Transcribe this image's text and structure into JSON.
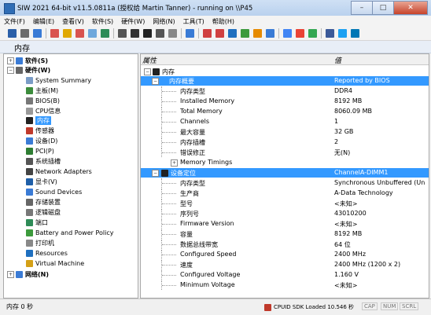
{
  "window": {
    "title": "SIW 2021 64-bit v11.5.0811a (授权给 Martin Tanner) - running on \\\\P45",
    "min": "–",
    "max": "□",
    "close": "✕"
  },
  "menu": [
    "文件(F)",
    "编辑(E)",
    "查看(V)",
    "软件(S)",
    "硬件(W)",
    "网络(N)",
    "工具(T)",
    "帮助(H)"
  ],
  "header": {
    "title": "内存"
  },
  "tree": {
    "software": "软件(S)",
    "hardware": "硬件(W)",
    "items": [
      "System Summary",
      "主板(M)",
      "BIOS(B)",
      "CPU信息",
      "内存",
      "传感器",
      "设备(D)",
      "PCI(P)",
      "系统插槽",
      "Network Adapters",
      "显卡(V)",
      "Sound Devices",
      "存储装置",
      "逻辑磁盘",
      "端口",
      "Battery and Power Policy",
      "打印机",
      "Resources",
      "Virtual Machine"
    ],
    "network": "网络(N)"
  },
  "columns": {
    "property": "属性",
    "value": "值"
  },
  "root": "内存",
  "sections": [
    {
      "title": "内存概要",
      "value": "Reported by BIOS",
      "rows": [
        {
          "p": "内存类型",
          "v": "DDR4"
        },
        {
          "p": "Installed Memory",
          "v": "8192 MB"
        },
        {
          "p": "Total Memory",
          "v": "8060.09 MB"
        },
        {
          "p": "Channels",
          "v": "1"
        },
        {
          "p": "最大容量",
          "v": "32 GB"
        },
        {
          "p": "内存插槽",
          "v": "2"
        },
        {
          "p": "错误修正",
          "v": "无(N)"
        },
        {
          "p": "Memory Timings",
          "v": ""
        }
      ]
    },
    {
      "title": "设备定位",
      "value": "ChannelA-DIMM1",
      "rows": [
        {
          "p": "内存类型",
          "v": "Synchronous Unbuffered (Un"
        },
        {
          "p": "生产商",
          "v": "A-Data Technology"
        },
        {
          "p": "型号",
          "v": "<未知>"
        },
        {
          "p": "序列号",
          "v": "43010200"
        },
        {
          "p": "Firmware Version",
          "v": "<未知>"
        },
        {
          "p": "容量",
          "v": "8192 MB"
        },
        {
          "p": "数据总线带宽",
          "v": "64 位"
        },
        {
          "p": "Configured Speed",
          "v": "2400 MHz"
        },
        {
          "p": "速度",
          "v": "2400 MHz (1200 x 2)"
        },
        {
          "p": "Configured Voltage",
          "v": "1.160 V"
        },
        {
          "p": "Minimum Voltage",
          "v": "<未知>"
        }
      ]
    }
  ],
  "status": {
    "left": "内存 0 秒",
    "cpu": "CPUID SDK Loaded 10.546 秒",
    "cap": "CAP",
    "num": "NUM",
    "scrl": "SCRL"
  }
}
